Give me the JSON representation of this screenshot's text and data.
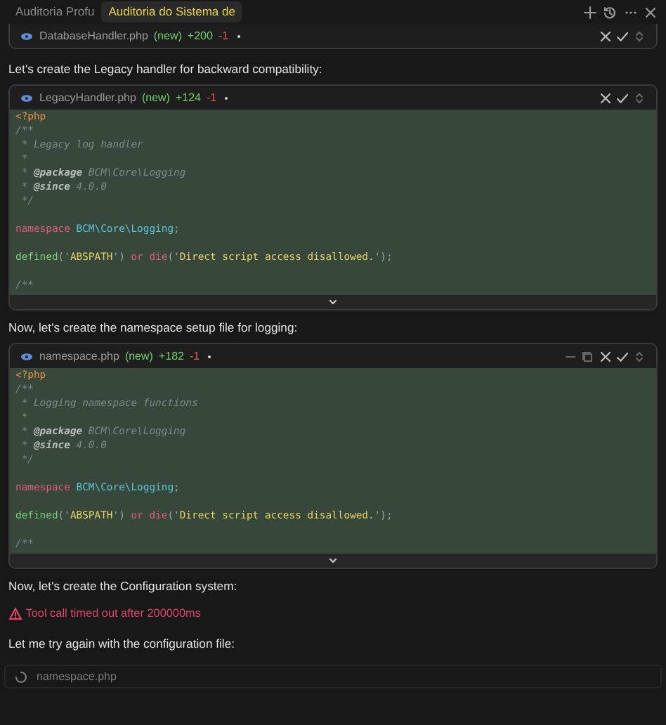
{
  "tabs": [
    {
      "label": "Auditoria Profu",
      "selected": false
    },
    {
      "label": "Auditoria do Sistema de",
      "selected": true
    }
  ],
  "messages": [
    {
      "kind": "file",
      "filename": "DatabaseHandler.php",
      "status": "(new)",
      "added": "+200",
      "removed": "-1",
      "unsaved": true,
      "actions": [
        {
          "kind": "reject"
        },
        {
          "kind": "accept"
        },
        {
          "kind": "toggle"
        }
      ]
    },
    {
      "kind": "text",
      "text": "Let's create the Legacy handler for backward compatibility:"
    },
    {
      "kind": "file",
      "filename": "LegacyHandler.php",
      "status": "(new)",
      "added": "+124",
      "removed": "-1",
      "unsaved": true,
      "actions": [
        {
          "kind": "reject"
        },
        {
          "kind": "accept"
        },
        {
          "kind": "toggle"
        }
      ],
      "lines": [
        {
          "kind": "code",
          "segments": [
            {
              "text": "<?php",
              "kind": "tag"
            }
          ]
        },
        {
          "kind": "code",
          "segments": [
            {
              "text": "/**",
              "kind": "comment"
            }
          ]
        },
        {
          "kind": "code",
          "segments": [
            {
              "text": " * Legacy log handler",
              "kind": "comment"
            }
          ]
        },
        {
          "kind": "code",
          "segments": [
            {
              "text": " *",
              "kind": "comment"
            }
          ]
        },
        {
          "kind": "code",
          "segments": [
            {
              "text": " * ",
              "kind": "comment"
            },
            {
              "text": "@package",
              "kind": "doc"
            },
            {
              "text": " BCM\\Core\\Logging",
              "kind": "comment"
            }
          ]
        },
        {
          "kind": "code",
          "segments": [
            {
              "text": " * ",
              "kind": "comment"
            },
            {
              "text": "@since",
              "kind": "doc"
            },
            {
              "text": " 4.0.0",
              "kind": "comment"
            }
          ]
        },
        {
          "kind": "code",
          "segments": [
            {
              "text": " */",
              "kind": "comment"
            }
          ]
        },
        {
          "kind": "blank"
        },
        {
          "kind": "code",
          "segments": [
            {
              "text": "namespace",
              "kind": "keyword"
            },
            {
              "text": " BCM\\Core\\Logging",
              "kind": "ns"
            },
            {
              "text": ";",
              "kind": "punct"
            }
          ]
        },
        {
          "kind": "blank"
        },
        {
          "kind": "code",
          "segments": [
            {
              "text": "defined",
              "kind": "func"
            },
            {
              "text": "('",
              "kind": "punct"
            },
            {
              "text": "ABSPATH",
              "kind": "string"
            },
            {
              "text": "') ",
              "kind": "punct"
            },
            {
              "text": "or die",
              "kind": "keyword"
            },
            {
              "text": "('",
              "kind": "punct"
            },
            {
              "text": "Direct script access disallowed.",
              "kind": "string"
            },
            {
              "text": "');",
              "kind": "punct"
            }
          ]
        },
        {
          "kind": "blank"
        },
        {
          "kind": "code",
          "segments": [
            {
              "text": "/**",
              "kind": "comment"
            }
          ]
        }
      ]
    },
    {
      "kind": "text",
      "text": "Now, let's create the namespace setup file for logging:"
    },
    {
      "kind": "file",
      "filename": "namespace.php",
      "status": "(new)",
      "added": "+182",
      "removed": "-1",
      "unsaved": true,
      "actions": [
        {
          "kind": "minimize"
        },
        {
          "kind": "copy"
        },
        {
          "kind": "reject"
        },
        {
          "kind": "accept"
        },
        {
          "kind": "toggle"
        }
      ],
      "lines": [
        {
          "kind": "code",
          "segments": [
            {
              "text": "<?php",
              "kind": "tag"
            }
          ]
        },
        {
          "kind": "code",
          "segments": [
            {
              "text": "/**",
              "kind": "comment"
            }
          ]
        },
        {
          "kind": "code",
          "segments": [
            {
              "text": " * Logging namespace functions",
              "kind": "comment"
            }
          ]
        },
        {
          "kind": "code",
          "segments": [
            {
              "text": " *",
              "kind": "comment"
            }
          ]
        },
        {
          "kind": "code",
          "segments": [
            {
              "text": " * ",
              "kind": "comment"
            },
            {
              "text": "@package",
              "kind": "doc"
            },
            {
              "text": " BCM\\Core\\Logging",
              "kind": "comment"
            }
          ]
        },
        {
          "kind": "code",
          "segments": [
            {
              "text": " * ",
              "kind": "comment"
            },
            {
              "text": "@since",
              "kind": "doc"
            },
            {
              "text": " 4.0.0",
              "kind": "comment"
            }
          ]
        },
        {
          "kind": "code",
          "segments": [
            {
              "text": " */",
              "kind": "comment"
            }
          ]
        },
        {
          "kind": "blank"
        },
        {
          "kind": "code",
          "segments": [
            {
              "text": "namespace",
              "kind": "keyword"
            },
            {
              "text": " BCM\\Core\\Logging",
              "kind": "ns"
            },
            {
              "text": ";",
              "kind": "punct"
            }
          ]
        },
        {
          "kind": "blank"
        },
        {
          "kind": "code",
          "segments": [
            {
              "text": "defined",
              "kind": "func"
            },
            {
              "text": "('",
              "kind": "punct"
            },
            {
              "text": "ABSPATH",
              "kind": "string"
            },
            {
              "text": "') ",
              "kind": "punct"
            },
            {
              "text": "or die",
              "kind": "keyword"
            },
            {
              "text": "('",
              "kind": "punct"
            },
            {
              "text": "Direct script access disallowed.",
              "kind": "string"
            },
            {
              "text": "');",
              "kind": "punct"
            }
          ]
        },
        {
          "kind": "blank"
        },
        {
          "kind": "code",
          "segments": [
            {
              "text": "/**",
              "kind": "comment"
            }
          ]
        }
      ]
    },
    {
      "kind": "text",
      "text": "Now, let's create the Configuration system:"
    },
    {
      "kind": "error",
      "text": "Tool call timed out after 200000ms"
    },
    {
      "kind": "text",
      "text": "Let me try again with the configuration file:"
    },
    {
      "kind": "loading",
      "filename": "namespace.php"
    }
  ]
}
